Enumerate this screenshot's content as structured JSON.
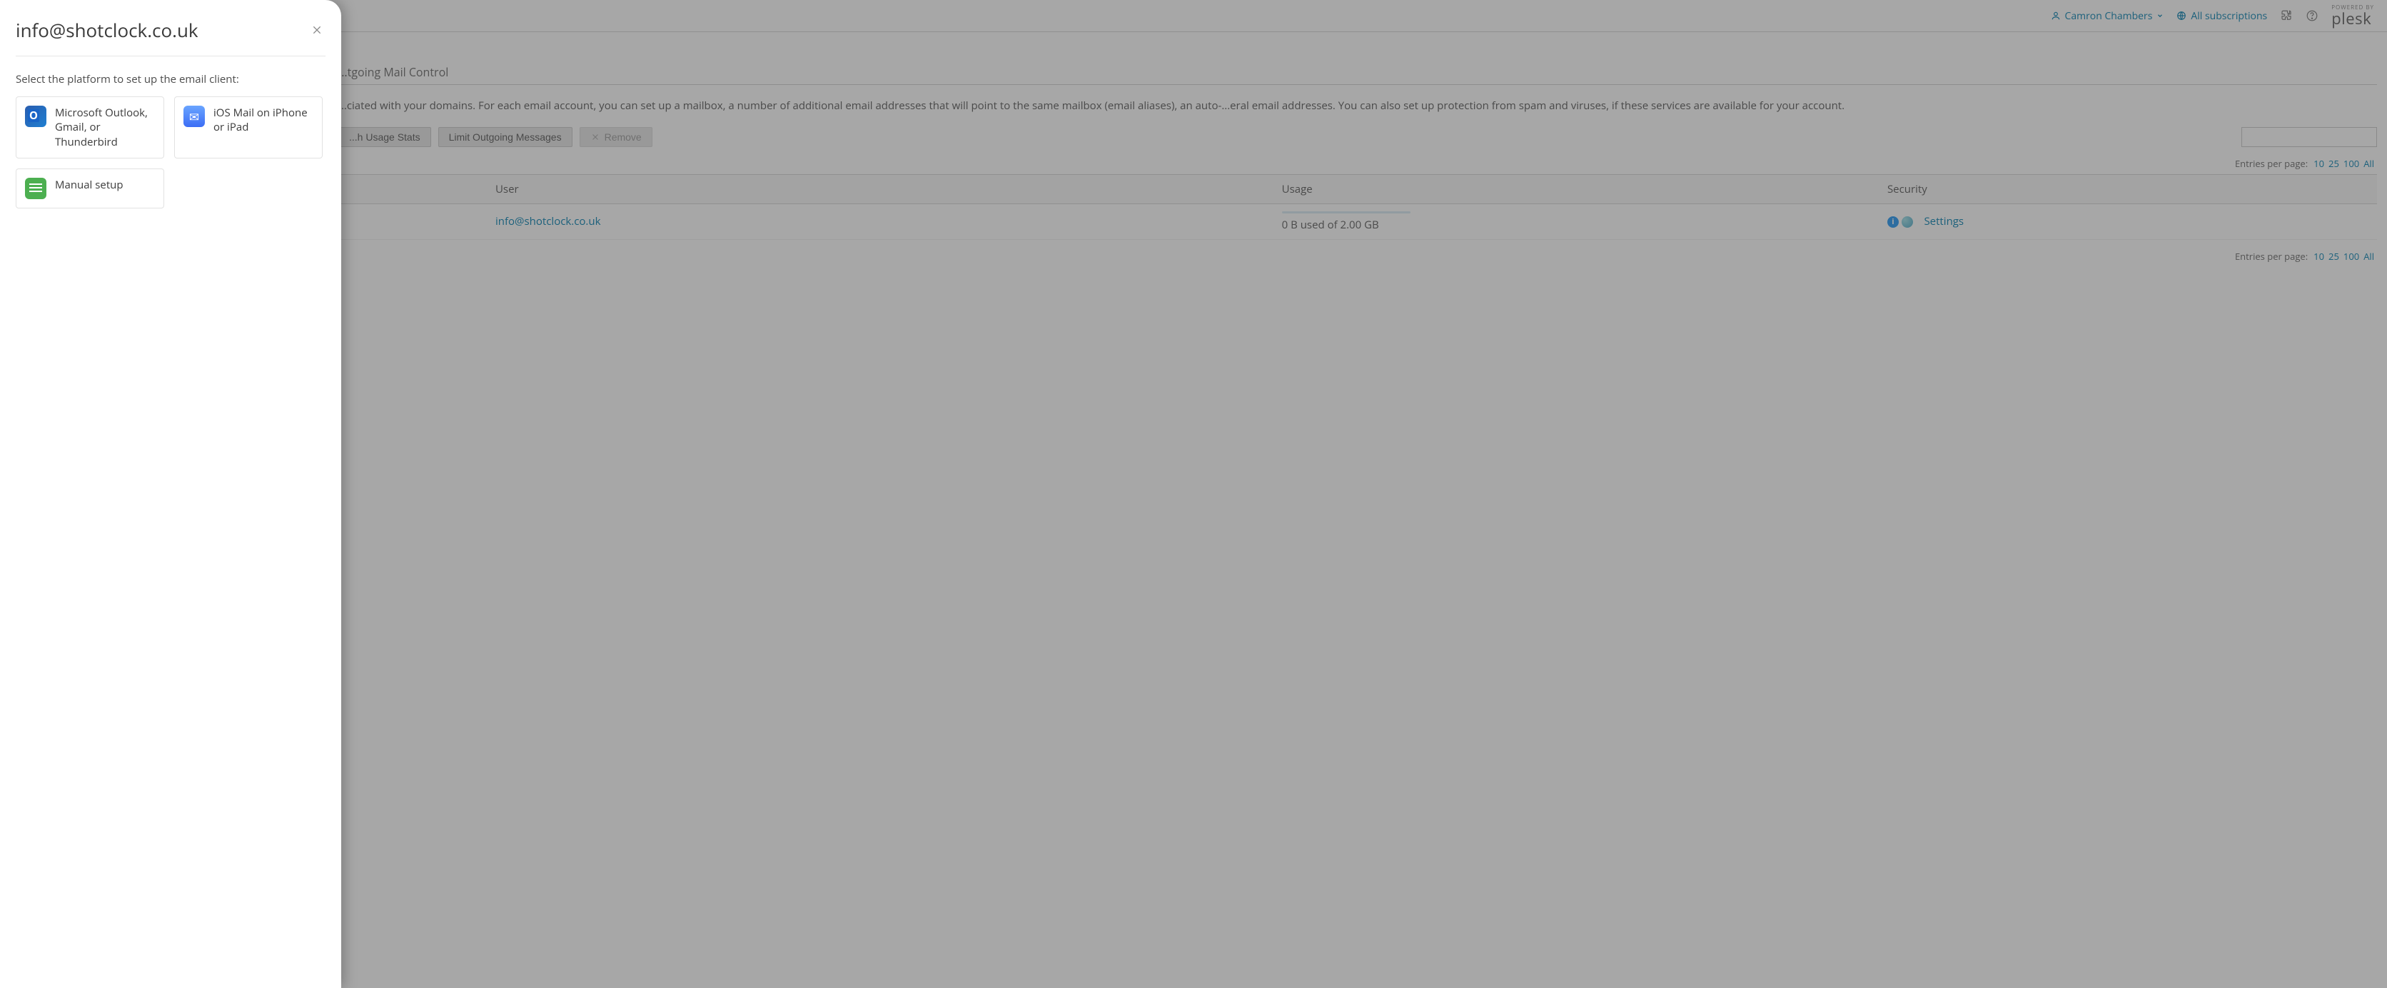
{
  "topbar": {
    "user_name": "Camron Chambers",
    "subscriptions_label": "All subscriptions",
    "brand_powered": "POWERED BY",
    "brand_name": "plesk"
  },
  "tabs": {
    "visible_partial_1": "...tgoing Mail Control"
  },
  "description": {
    "line": "...ciated with your domains. For each email account, you can set up a mailbox, a number of additional email addresses that will point to the same mailbox (email aliases), an auto-...eral email addresses. You can also set up protection from spam and viruses, if these services are available for your account."
  },
  "actions": {
    "usage_stats": "...h Usage Stats",
    "limit_outgoing": "Limit Outgoing Messages",
    "remove": "Remove"
  },
  "pager": {
    "label": "Entries per page:",
    "o1": "10",
    "o2": "25",
    "o3": "100",
    "o4": "All"
  },
  "table": {
    "col_user": "User",
    "col_usage": "Usage",
    "col_security": "Security",
    "row1": {
      "user": "info@shotclock.co.uk",
      "usage": "0 B used of 2.00 GB",
      "security_link": "Settings"
    }
  },
  "drawer": {
    "title": "info@shotclock.co.uk",
    "subtitle": "Select the platform to set up the email client:",
    "cards": [
      {
        "id": "outlook",
        "label": "Microsoft Outlook, Gmail, or Thunderbird"
      },
      {
        "id": "ios",
        "label": "iOS Mail on iPhone or iPad"
      },
      {
        "id": "manual",
        "label": "Manual setup"
      }
    ]
  }
}
